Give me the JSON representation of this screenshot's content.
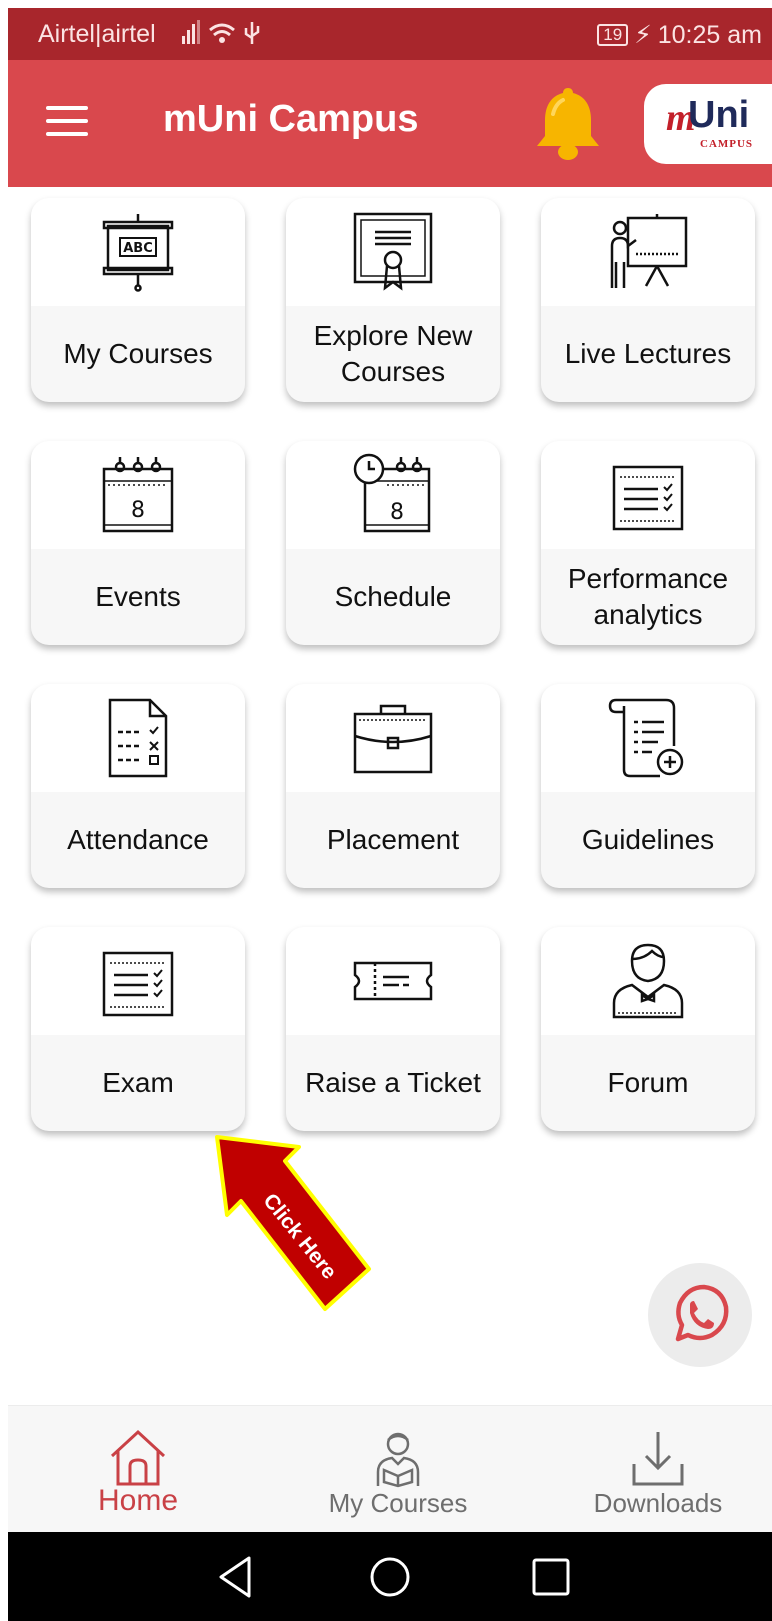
{
  "status_bar": {
    "carrier": "Airtel|airtel",
    "battery": "19",
    "time": "10:25 am"
  },
  "app_bar": {
    "title": "mUni Campus",
    "logo_m": "m",
    "logo_text": "Uni",
    "logo_sub": "CAMPUS"
  },
  "tiles": [
    {
      "label": "My Courses",
      "icon": "abc-board-icon"
    },
    {
      "label": "Explore New Courses",
      "icon": "certificate-icon"
    },
    {
      "label": "Live Lectures",
      "icon": "presenter-icon"
    },
    {
      "label": "Events",
      "icon": "calendar-icon"
    },
    {
      "label": "Schedule",
      "icon": "calendar-clock-icon"
    },
    {
      "label": "Performance analytics",
      "icon": "checklist-icon"
    },
    {
      "label": "Attendance",
      "icon": "attendance-sheet-icon"
    },
    {
      "label": "Placement",
      "icon": "briefcase-icon"
    },
    {
      "label": "Guidelines",
      "icon": "scroll-icon"
    },
    {
      "label": "Exam",
      "icon": "exam-checklist-icon"
    },
    {
      "label": "Raise a Ticket",
      "icon": "ticket-icon"
    },
    {
      "label": "Forum",
      "icon": "user-forum-icon"
    }
  ],
  "annotation": {
    "text": "Click Here",
    "color": "#c00000",
    "border_color": "#ffff00"
  },
  "bottom_nav": [
    {
      "label": "Home",
      "icon": "home-icon",
      "active": true
    },
    {
      "label": "My Courses",
      "icon": "student-icon",
      "active": false
    },
    {
      "label": "Downloads",
      "icon": "download-icon",
      "active": false
    }
  ],
  "colors": {
    "status_bar": "#a8262c",
    "app_bar": "#d9484d",
    "accent": "#c94146",
    "bell": "#f7b500",
    "whatsapp": "#d9484d"
  }
}
